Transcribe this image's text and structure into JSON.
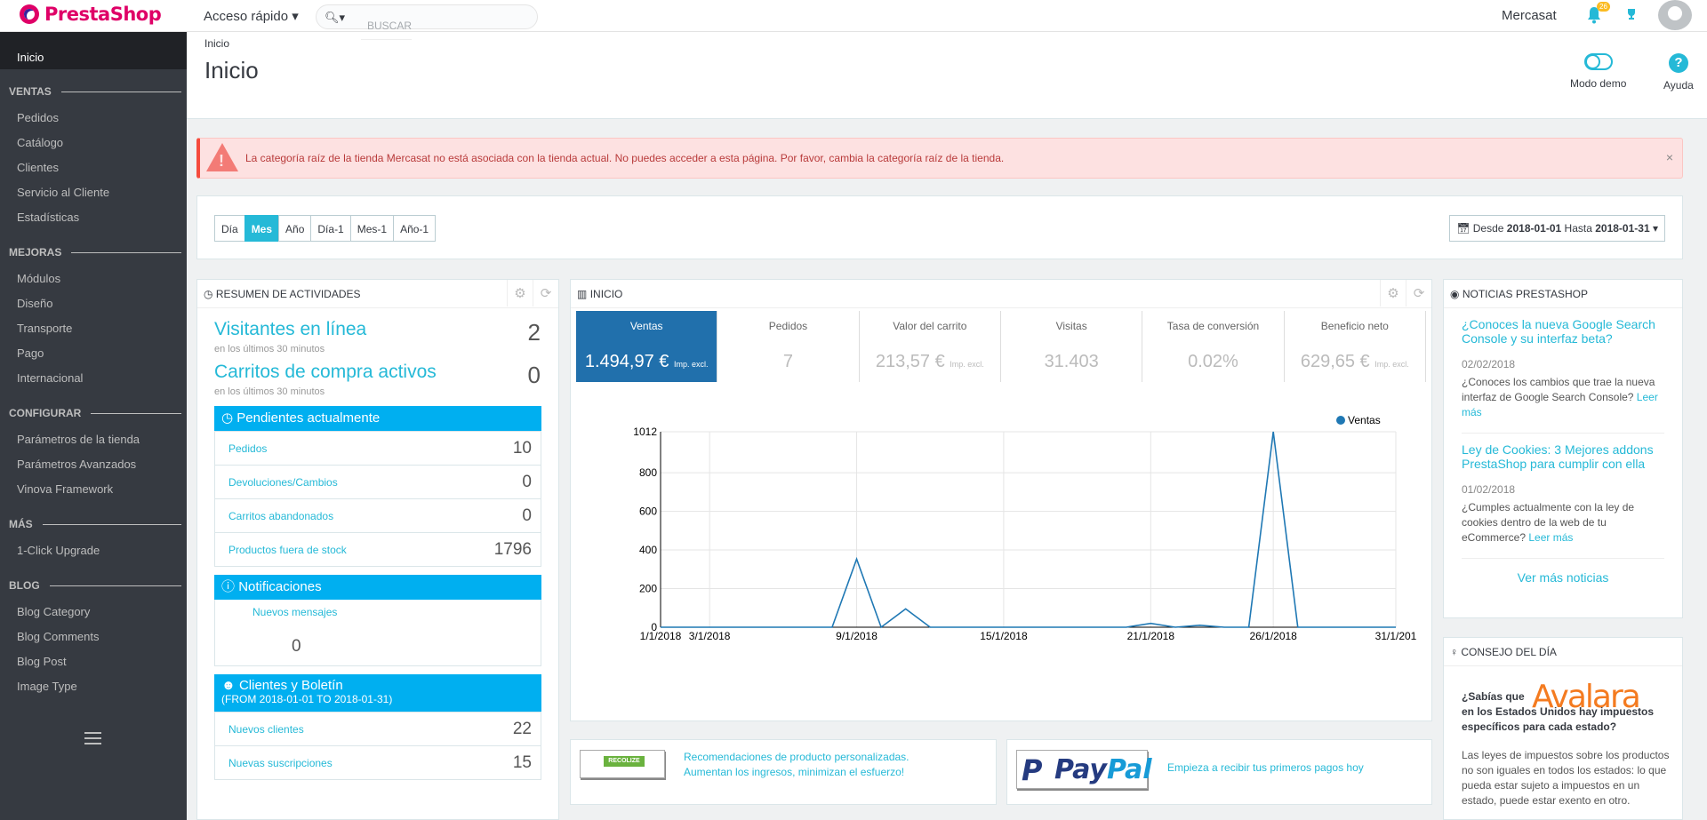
{
  "topbar": {
    "logo": "PrestaShop",
    "quick_access": "Acceso rápido ▾",
    "search_placeholder": "Buscar",
    "shop_name": "Mercasat",
    "notif_count": "26"
  },
  "sidebar": {
    "home": "Inicio",
    "sections": [
      {
        "title": "VENTAS",
        "items": [
          "Pedidos",
          "Catálogo",
          "Clientes",
          "Servicio al Cliente",
          "Estadísticas"
        ]
      },
      {
        "title": "MEJORAS",
        "items": [
          "Módulos",
          "Diseño",
          "Transporte",
          "Pago",
          "Internacional"
        ]
      },
      {
        "title": "CONFIGURAR",
        "items": [
          "Parámetros de la tienda",
          "Parámetros Avanzados",
          "Vinova Framework"
        ]
      },
      {
        "title": "MÁS",
        "items": [
          "1-Click Upgrade"
        ]
      },
      {
        "title": "BLOG",
        "items": [
          "Blog Category",
          "Blog Comments",
          "Blog Post",
          "Image Type"
        ]
      }
    ]
  },
  "header": {
    "breadcrumb": "Inicio",
    "title": "Inicio",
    "demo_label": "Modo demo",
    "help_label": "Ayuda"
  },
  "alert": {
    "message": "La categoría raíz de la tienda Mercasat no está asociada con la tienda actual. No puedes acceder a esta página. Por favor, cambia la categoría raíz de la tienda."
  },
  "periods": {
    "buttons": [
      "Día",
      "Mes",
      "Año",
      "Día-1",
      "Mes-1",
      "Año-1"
    ],
    "active": "Mes",
    "range_from_label": "Desde",
    "range_from": "2018-01-01",
    "range_to_label": "Hasta",
    "range_to": "2018-01-31"
  },
  "activity": {
    "title": "RESUMEN DE ACTIVIDADES",
    "online_label": "Visitantes en línea",
    "online_value": "2",
    "online_sub": "en los últimos 30 minutos",
    "carts_label": "Carritos de compra activos",
    "carts_value": "0",
    "carts_sub": "en los últimos 30 minutos",
    "pending_title": "Pendientes actualmente",
    "pending": [
      {
        "label": "Pedidos",
        "value": "10"
      },
      {
        "label": "Devoluciones/Cambios",
        "value": "0"
      },
      {
        "label": "Carritos abandonados",
        "value": "0"
      },
      {
        "label": "Productos fuera de stock",
        "value": "1796"
      }
    ],
    "notif_title": "Notificaciones",
    "notif_label": "Nuevos mensajes",
    "notif_value": "0",
    "clients_title": "Clientes y Boletín",
    "clients_sub": "(FROM 2018-01-01 TO 2018-01-31)",
    "clients": [
      {
        "label": "Nuevos clientes",
        "value": "22"
      },
      {
        "label": "Nuevas suscripciones",
        "value": "15"
      }
    ]
  },
  "dashboard": {
    "title": "INICIO",
    "kpis": [
      {
        "label": "Ventas",
        "value": "1.494,97 €",
        "unit": "Imp. excl."
      },
      {
        "label": "Pedidos",
        "value": "7",
        "unit": ""
      },
      {
        "label": "Valor del carrito",
        "value": "213,57 €",
        "unit": "Imp. excl."
      },
      {
        "label": "Visitas",
        "value": "31.403",
        "unit": ""
      },
      {
        "label": "Tasa de conversión",
        "value": "0.02%",
        "unit": ""
      },
      {
        "label": "Beneficio neto",
        "value": "629,65 €",
        "unit": "Imp. excl."
      }
    ]
  },
  "chart_data": {
    "type": "line",
    "x": [
      "1/1/2018",
      "2/1/2018",
      "3/1/2018",
      "4/1/2018",
      "5/1/2018",
      "6/1/2018",
      "7/1/2018",
      "8/1/2018",
      "9/1/2018",
      "10/1/2018",
      "11/1/2018",
      "12/1/2018",
      "13/1/2018",
      "14/1/2018",
      "15/1/2018",
      "16/1/2018",
      "17/1/2018",
      "18/1/2018",
      "19/1/2018",
      "20/1/2018",
      "21/1/2018",
      "22/1/2018",
      "23/1/2018",
      "24/1/2018",
      "25/1/2018",
      "26/1/2018",
      "27/1/2018",
      "28/1/2018",
      "29/1/2018",
      "30/1/2018",
      "31/1/2018"
    ],
    "series": [
      {
        "name": "Ventas",
        "values": [
          0,
          0,
          0,
          0,
          0,
          0,
          0,
          0,
          353,
          0,
          95,
          0,
          0,
          0,
          0,
          0,
          0,
          0,
          0,
          0,
          20,
          0,
          10,
          0,
          0,
          1012,
          0,
          0,
          0,
          0,
          0
        ]
      }
    ],
    "xticks": [
      "1/1/2018",
      "3/1/2018",
      "9/1/2018",
      "15/1/2018",
      "21/1/2018",
      "26/1/2018",
      "31/1/201"
    ],
    "yticks": [
      "0",
      "200",
      "400",
      "600",
      "800",
      "1012"
    ],
    "ylim": [
      0,
      1012
    ],
    "grid": true,
    "legend": "top-right",
    "color": "#1f78b4"
  },
  "news": {
    "title": "NOTICIAS PRESTASHOP",
    "items": [
      {
        "title": "¿Conoces la nueva Google Search Console y su interfaz beta?",
        "date": "02/02/2018",
        "text": "¿Conoces los cambios que trae la nueva interfaz de Google Search Console?",
        "link": "Leer más"
      },
      {
        "title": "Ley de Cookies: 3 Mejores addons PrestaShop para cumplir con ella",
        "date": "01/02/2018",
        "text": "¿Cumples actualmente con la ley de cookies dentro de la web de tu eCommerce?",
        "link": "Leer más"
      }
    ],
    "more": "Ver más noticias"
  },
  "tip": {
    "title": "CONSEJO DEL DÍA",
    "brand": "Avalara",
    "question_a": "¿Sabías que",
    "question_b": "en los Estados Unidos hay impuestos específicos para cada estado?",
    "body": "Las leyes de impuestos sobre los productos no son iguales en todos los estados: lo que pueda estar sujeto a impuestos en un estado, puede estar exento en otro."
  },
  "recolize": {
    "logo": "RECOLIZE",
    "line1": "Recomendaciones de producto personalizadas.",
    "line2": "Aumentan los ingresos, minimizan el esfuerzo!"
  },
  "paypal": {
    "logo_a": "Pay",
    "logo_b": "Pal",
    "text": "Empieza a recibir tus primeros pagos hoy"
  }
}
